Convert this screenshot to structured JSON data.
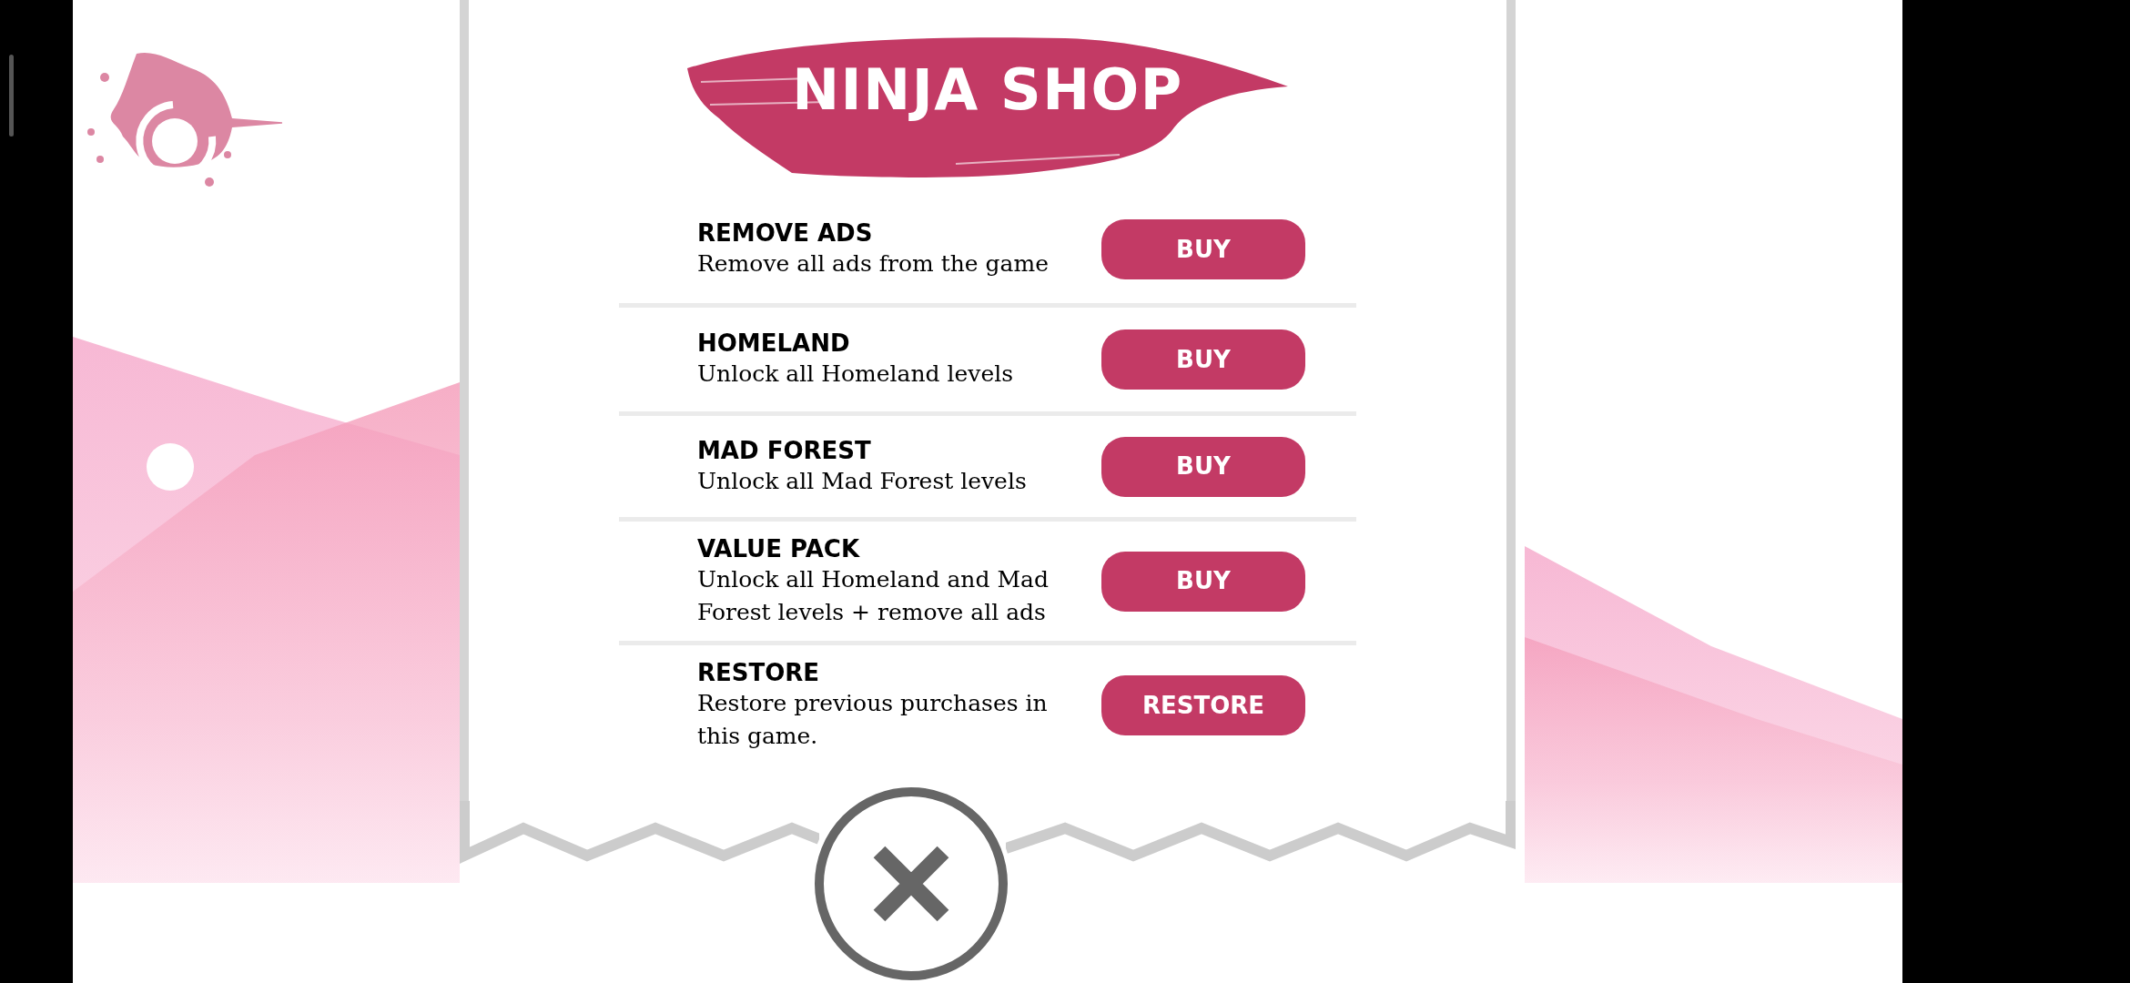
{
  "title": "NINJA SHOP",
  "items": [
    {
      "name": "REMOVE ADS",
      "description": "Remove all ads from the game",
      "button": "BUY"
    },
    {
      "name": "HOMELAND",
      "description": "Unlock all Homeland levels",
      "button": "BUY"
    },
    {
      "name": "MAD FOREST",
      "description": "Unlock all Mad Forest levels",
      "button": "BUY"
    },
    {
      "name": "VALUE PACK",
      "description": "Unlock all Homeland and Mad Forest levels + remove all ads",
      "button": "BUY"
    },
    {
      "name": "RESTORE",
      "description": "Restore previous purchases in this game.",
      "button": "RESTORE"
    }
  ]
}
